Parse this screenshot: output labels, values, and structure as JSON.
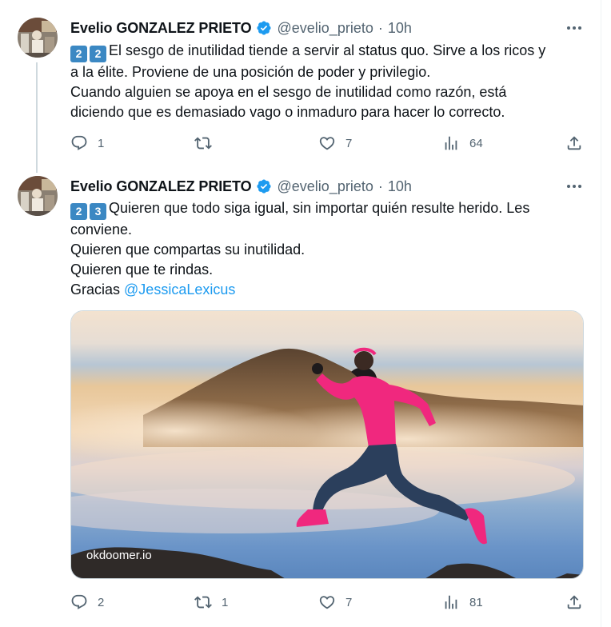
{
  "tweets": [
    {
      "author_name": "Evelio GONZALEZ PRIETO",
      "handle": "@evelio_prieto",
      "separator": "·",
      "time": "10h",
      "keycaps": [
        "2",
        "2"
      ],
      "lines": [
        "El sesgo de inutilidad tiende a servir al status quo. Sirve a los ricos y",
        "a la élite. Proviene de una posición de poder y privilegio.",
        "Cuando alguien se apoya en el sesgo de inutilidad como razón, está",
        "diciendo que es demasiado vago o inmaduro para hacer lo correcto."
      ],
      "replies": "1",
      "retweets": "",
      "likes": "7",
      "views": "64"
    },
    {
      "author_name": "Evelio GONZALEZ PRIETO",
      "handle": "@evelio_prieto",
      "separator": "·",
      "time": "10h",
      "keycaps": [
        "2",
        "3"
      ],
      "lines": [
        "Quieren que todo siga igual, sin importar quién resulte herido. Les",
        "conviene.",
        "Quieren que compartas su inutilidad.",
        "Quieren que te rindas."
      ],
      "thanks_text": "Gracias",
      "mention": "@JessicaLexicus",
      "media_source": "okdoomer.io",
      "replies": "2",
      "retweets": "1",
      "likes": "7",
      "views": "81"
    }
  ],
  "colors": {
    "accent": "#1d9bf0",
    "muted": "#536471",
    "keycap": "#3b88c3",
    "shoe_and_shirt": "#f0287e"
  },
  "icons": {
    "verified": "verified-badge-icon",
    "more": "more-horizontal-icon",
    "reply": "reply-icon",
    "retweet": "retweet-icon",
    "like": "heart-icon",
    "views": "views-chart-icon",
    "share": "share-icon"
  }
}
